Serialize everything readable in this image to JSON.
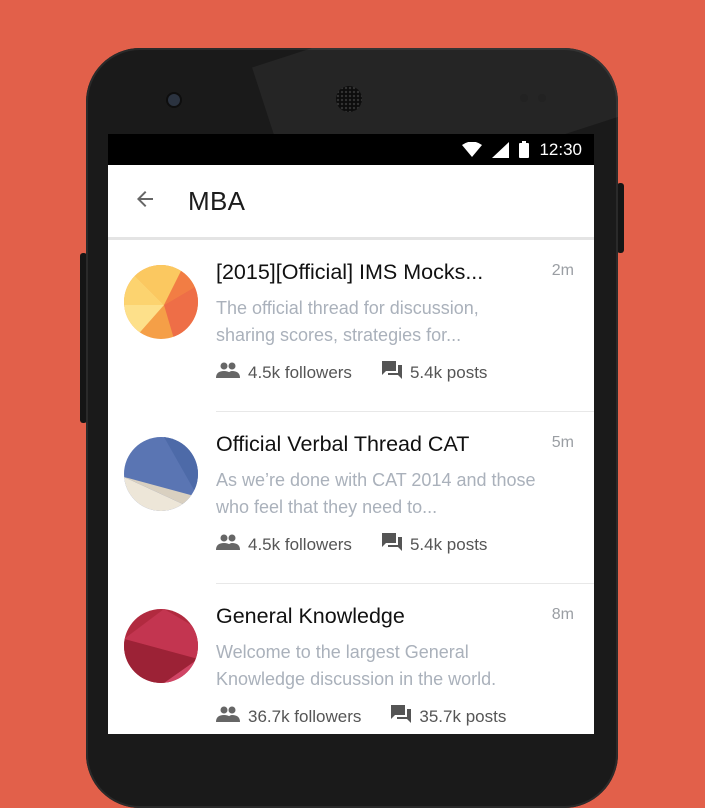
{
  "status_bar": {
    "time": "12:30"
  },
  "app_bar": {
    "title": "MBA"
  },
  "threads": [
    {
      "title": "[2015][Official] IMS Mocks...",
      "time": "2m",
      "preview": "The official thread for discussion, sharing scores, strategies for...",
      "followers": "4.5k followers",
      "posts": "5.4k posts"
    },
    {
      "title": "Official Verbal Thread CAT",
      "time": "5m",
      "preview": "As we’re done with CAT 2014 and those who feel that they need to...",
      "followers": "4.5k followers",
      "posts": "5.4k posts"
    },
    {
      "title": "General Knowledge",
      "time": "8m",
      "preview": "Welcome to the largest General Knowledge discussion in the world.",
      "followers": "36.7k followers",
      "posts": "35.7k posts"
    }
  ],
  "colors": {
    "background": "#e2604a",
    "accent_orange": "#f4a04b",
    "accent_blue": "#5b77b6",
    "accent_red": "#b2283e"
  },
  "icons": [
    "back-arrow-icon",
    "wifi-icon",
    "signal-icon",
    "battery-icon",
    "followers-icon",
    "posts-icon"
  ]
}
